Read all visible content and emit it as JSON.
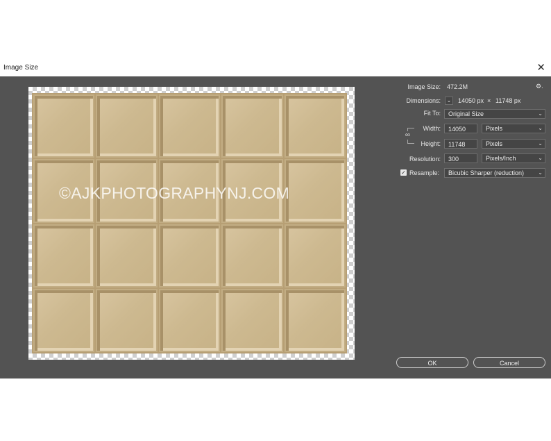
{
  "window": {
    "title": "Image Size",
    "close_glyph": "✕"
  },
  "preview": {
    "watermark": "©AJKPHOTOGRAPHYNJ.COM"
  },
  "settings": {
    "image_size_label": "Image Size:",
    "image_size_value": "472.2M",
    "gear_glyph": "⚙.",
    "dimensions_label": "Dimensions:",
    "dimensions_width": "14050 px",
    "dimensions_sep": "×",
    "dimensions_height": "11748 px",
    "fit_to_label": "Fit To:",
    "fit_to_value": "Original Size",
    "width_label": "Width:",
    "width_value": "14050",
    "width_unit": "Pixels",
    "height_label": "Height:",
    "height_value": "11748",
    "height_unit": "Pixels",
    "resolution_label": "Resolution:",
    "resolution_value": "300",
    "resolution_unit": "Pixels/Inch",
    "resample_label": "Resample:",
    "resample_checked": true,
    "resample_value": "Bicubic Sharper (reduction)"
  },
  "buttons": {
    "ok": "OK",
    "cancel": "Cancel"
  },
  "colors": {
    "panel": "#535353",
    "field": "#454545",
    "frame": "#b79f74"
  }
}
